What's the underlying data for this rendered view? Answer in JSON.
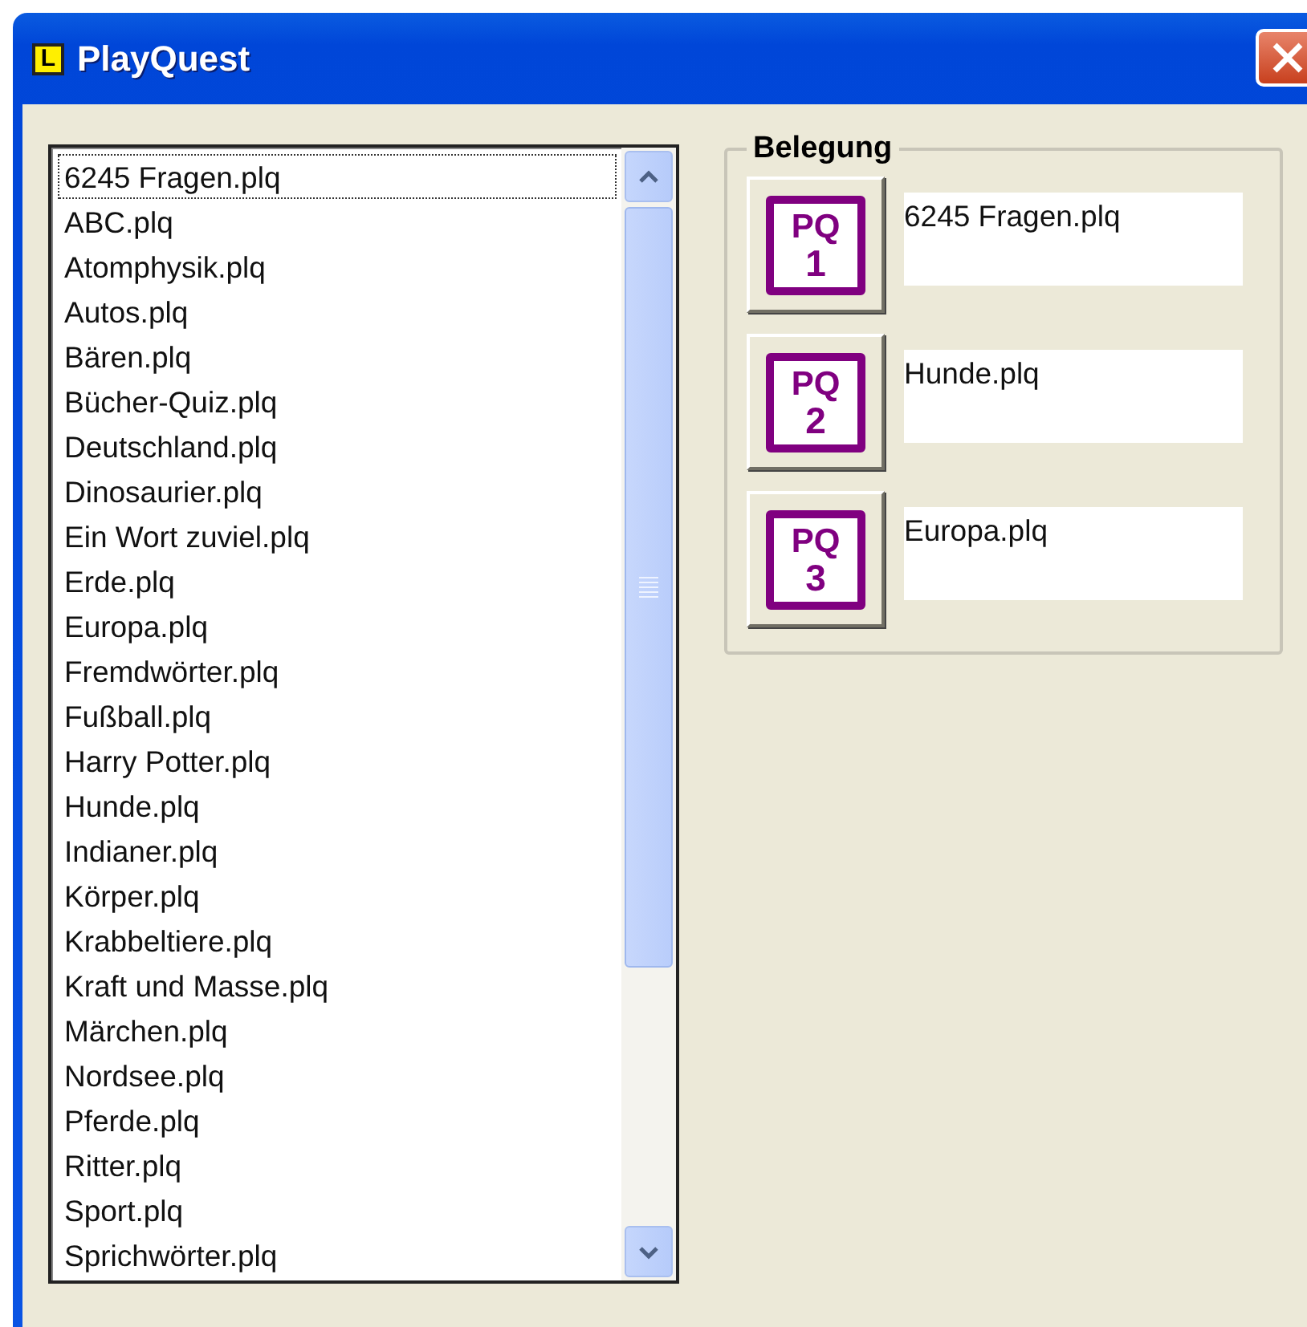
{
  "window": {
    "title": "PlayQuest",
    "icon_letter": "L"
  },
  "file_list": {
    "items": [
      {
        "label": "6245 Fragen.plq",
        "focused": true
      },
      {
        "label": "ABC.plq",
        "focused": false
      },
      {
        "label": "Atomphysik.plq",
        "focused": false
      },
      {
        "label": "Autos.plq",
        "focused": false
      },
      {
        "label": "Bären.plq",
        "focused": false
      },
      {
        "label": "Bücher-Quiz.plq",
        "focused": false
      },
      {
        "label": "Deutschland.plq",
        "focused": false
      },
      {
        "label": "Dinosaurier.plq",
        "focused": false
      },
      {
        "label": "Ein Wort zuviel.plq",
        "focused": false
      },
      {
        "label": "Erde.plq",
        "focused": false
      },
      {
        "label": "Europa.plq",
        "focused": false
      },
      {
        "label": "Fremdwörter.plq",
        "focused": false
      },
      {
        "label": "Fußball.plq",
        "focused": false
      },
      {
        "label": "Harry Potter.plq",
        "focused": false
      },
      {
        "label": "Hunde.plq",
        "focused": false
      },
      {
        "label": "Indianer.plq",
        "focused": false
      },
      {
        "label": "Körper.plq",
        "focused": false
      },
      {
        "label": "Krabbeltiere.plq",
        "focused": false
      },
      {
        "label": "Kraft und Masse.plq",
        "focused": false
      },
      {
        "label": "Märchen.plq",
        "focused": false
      },
      {
        "label": "Nordsee.plq",
        "focused": false
      },
      {
        "label": "Pferde.plq",
        "focused": false
      },
      {
        "label": "Ritter.plq",
        "focused": false
      },
      {
        "label": "Sport.plq",
        "focused": false
      },
      {
        "label": "Sprichwörter.plq",
        "focused": false
      }
    ]
  },
  "assignment": {
    "title": "Belegung",
    "slots": [
      {
        "badge": "PQ",
        "number": "1",
        "value": "6245 Fragen.plq"
      },
      {
        "badge": "PQ",
        "number": "2",
        "value": "Hunde.plq"
      },
      {
        "badge": "PQ",
        "number": "3",
        "value": "Europa.plq"
      }
    ]
  }
}
